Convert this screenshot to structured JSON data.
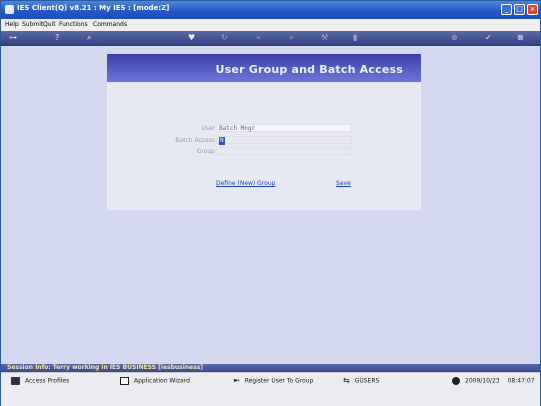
{
  "window": {
    "title": "IES Client(Q) v8.21 : My IES :      [mode:Z]"
  },
  "menu": [
    "Help",
    "Submit",
    "Quit",
    "Functions",
    "Commands"
  ],
  "toolbar": {
    "icons": [
      "key-icon",
      "help-icon",
      "search-icon",
      "heart-icon",
      "refresh-icon",
      "rewind-icon",
      "fast-forward-icon",
      "tools-icon",
      "trash-icon",
      "globe-icon",
      "check-icon",
      "cancel-icon"
    ]
  },
  "form": {
    "title": "User Group and Batch Access",
    "user_label": "User",
    "user_value": "Batch Mngr",
    "batch_access_label": "Batch Access",
    "batch_access_value": "N",
    "group_label": "Group",
    "group_value": "",
    "define_group_link": "Define (New) Group",
    "save_link": "Save"
  },
  "session": {
    "text": "Session Info: Terry working in IES BUSINESS  [iesbusiness]"
  },
  "statusbar": {
    "items": [
      {
        "label": "Access Profiles",
        "icon": "book-icon"
      },
      {
        "label": "Application Wizard",
        "icon": "wizard-icon"
      },
      {
        "label": "Register User To Group",
        "icon": "register-icon"
      },
      {
        "label": "GUSERS",
        "icon": "group-icon"
      }
    ],
    "date": "2009/10/23",
    "time": "08:47:07"
  },
  "colors": {
    "titlebar": "#2559c8",
    "panel_header": "#3840a8",
    "background": "#d4d8f0",
    "link": "#2040c0"
  }
}
